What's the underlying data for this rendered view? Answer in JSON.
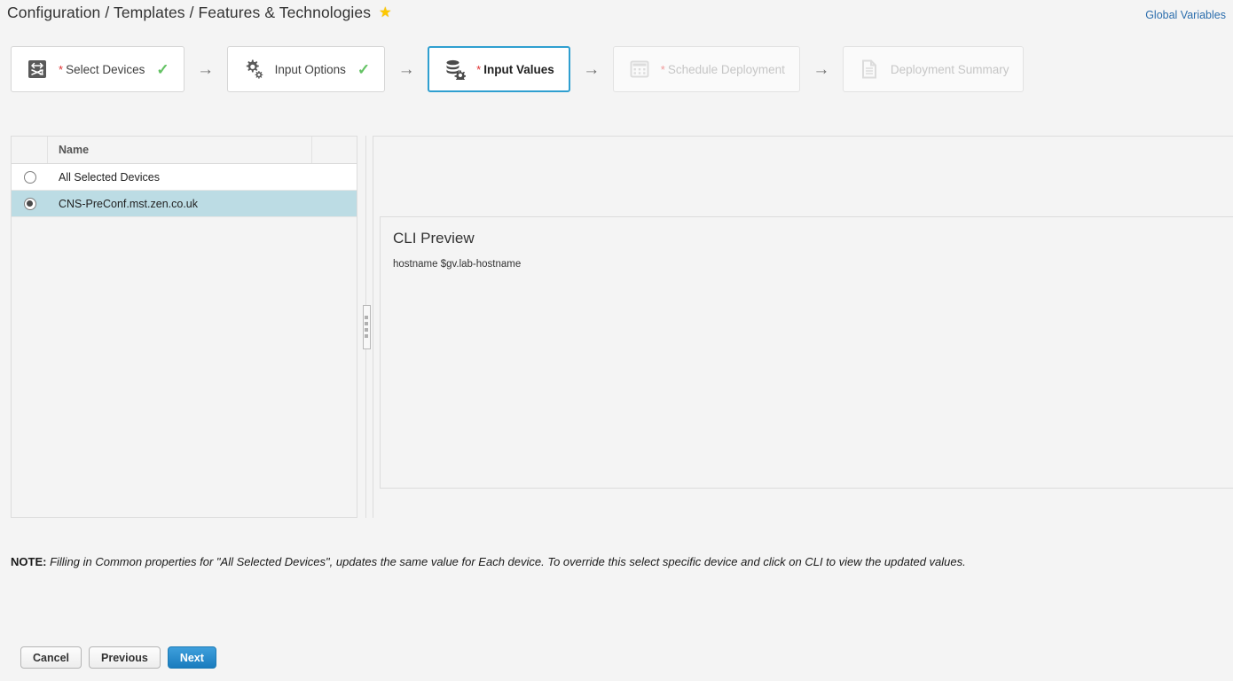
{
  "header": {
    "breadcrumb": "Configuration / Templates / Features & Technologies",
    "favorite_icon": "★",
    "global_variables_link": "Global Variables",
    "link_color": "#2c6ead",
    "star_color": "#fdc800"
  },
  "wizard": {
    "arrow": "→",
    "check": "✓",
    "required_marker": "*",
    "active_border_color": "#2f9fd0",
    "check_color": "#63c263",
    "steps": [
      {
        "id": "select-devices",
        "label": "Select Devices",
        "icon": "network-switch-icon",
        "required": true,
        "complete": true,
        "state": "complete"
      },
      {
        "id": "input-options",
        "label": "Input Options",
        "icon": "gear-options-icon",
        "required": false,
        "complete": true,
        "state": "complete"
      },
      {
        "id": "input-values",
        "label": "Input Values",
        "icon": "database-gear-icon",
        "required": true,
        "complete": false,
        "state": "active"
      },
      {
        "id": "schedule-deployment",
        "label": "Schedule Deployment",
        "icon": "calendar-icon",
        "required": true,
        "complete": false,
        "state": "disabled"
      },
      {
        "id": "deployment-summary",
        "label": "Deployment Summary",
        "icon": "document-list-icon",
        "required": false,
        "complete": false,
        "state": "disabled"
      }
    ]
  },
  "device_grid": {
    "columns": [
      "",
      "Name",
      ""
    ],
    "name_header": "Name",
    "selected_row_color": "#bcdce4",
    "rows": [
      {
        "name": "All Selected Devices",
        "selected": false
      },
      {
        "name": "CNS-PreConf.mst.zen.co.uk",
        "selected": true
      }
    ]
  },
  "cli_preview": {
    "title": "CLI Preview",
    "content": "hostname $gv.lab-hostname"
  },
  "note": {
    "prefix": "NOTE:",
    "text": " Filling in Common properties for \"All Selected Devices\", updates the same value for Each device. To override this select specific device and click on CLI to view the updated values."
  },
  "footer": {
    "cancel_label": "Cancel",
    "previous_label": "Previous",
    "next_label": "Next",
    "primary_color": "#1a7cbe"
  }
}
